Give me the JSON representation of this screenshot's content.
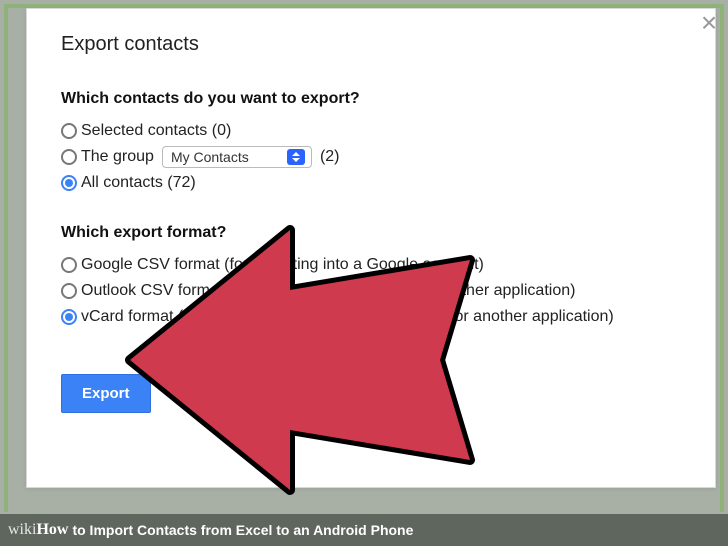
{
  "dialog": {
    "title": "Export contacts",
    "close_glyph": "×",
    "q1": "Which contacts do you want to export?",
    "opts1": {
      "selected": "Selected contacts (0)",
      "group_label": "The group",
      "group_select_value": "My Contacts",
      "group_count": "(2)",
      "all": "All contacts (72)"
    },
    "q2": "Which export format?",
    "opts2": {
      "gcsv": "Google CSV format (for importing into a Google account)",
      "ocsv": "Outlook CSV format (for importing into Outlook or another application)",
      "vcard": "vCard format (for importing into Apple Address Book or another application)"
    },
    "export_btn": "Export"
  },
  "caption": {
    "brand_prefix": "wiki",
    "brand_suffix": "How",
    "text": " to Import Contacts from Excel to an Android Phone"
  },
  "arrow": {
    "fill": "#cf3a4e",
    "stroke": "#000000"
  }
}
